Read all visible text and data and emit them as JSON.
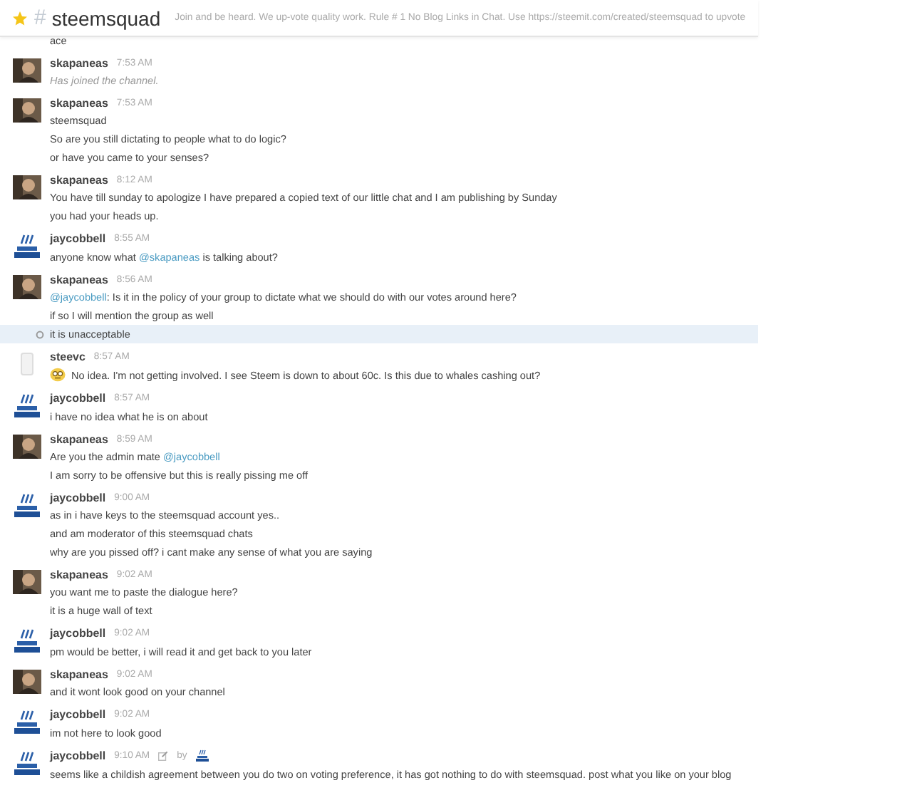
{
  "channel": {
    "starred": true,
    "hash": "#",
    "name": "steemsquad",
    "topic": "Join and be heard. We up-vote quality work. Rule # 1 No Blog Links in Chat. Use https://steemit.com/created/steemsquad to upvote"
  },
  "partial_line": "ace",
  "messages": [
    {
      "author": "skapaneas",
      "kind": "photo",
      "time": "7:53 AM",
      "edited": false,
      "lines": [
        {
          "kind": "system",
          "highlighted": false,
          "parts": [
            {
              "text": "Has joined the channel."
            }
          ]
        }
      ]
    },
    {
      "author": "skapaneas",
      "kind": "photo",
      "time": "7:53 AM",
      "edited": false,
      "lines": [
        {
          "kind": "text",
          "highlighted": false,
          "parts": [
            {
              "text": "steemsquad"
            }
          ]
        },
        {
          "kind": "text",
          "highlighted": false,
          "parts": [
            {
              "text": "So are you still dictating to people what to do logic?"
            }
          ]
        },
        {
          "kind": "text",
          "highlighted": false,
          "parts": [
            {
              "text": "or have you came to your senses?"
            }
          ]
        }
      ]
    },
    {
      "author": "skapaneas",
      "kind": "photo",
      "time": "8:12 AM",
      "edited": false,
      "lines": [
        {
          "kind": "text",
          "highlighted": false,
          "parts": [
            {
              "text": "You have till sunday to apologize I have prepared a copied text of our little chat and I am publishing by Sunday"
            }
          ]
        },
        {
          "kind": "text",
          "highlighted": false,
          "parts": [
            {
              "text": "you had your heads up."
            }
          ]
        }
      ]
    },
    {
      "author": "jaycobbell",
      "kind": "logo",
      "time": "8:55 AM",
      "edited": false,
      "lines": [
        {
          "kind": "text",
          "highlighted": false,
          "parts": [
            {
              "text": "anyone know what "
            },
            {
              "mention": "@skapaneas"
            },
            {
              "text": " is talking about?"
            }
          ]
        }
      ]
    },
    {
      "author": "skapaneas",
      "kind": "photo",
      "time": "8:56 AM",
      "edited": false,
      "lines": [
        {
          "kind": "text",
          "highlighted": false,
          "parts": [
            {
              "mention": "@jaycobbell"
            },
            {
              "text": ": Is it in the policy of your group to dictate what we should do with our votes around here?"
            }
          ]
        },
        {
          "kind": "text",
          "highlighted": false,
          "parts": [
            {
              "text": "if so I will mention the group as well"
            }
          ]
        },
        {
          "kind": "text",
          "highlighted": true,
          "parts": [
            {
              "text": "it is unacceptable"
            }
          ]
        }
      ]
    },
    {
      "author": "steevc",
      "kind": "blank",
      "time": "8:57 AM",
      "edited": false,
      "lines": [
        {
          "kind": "emoji",
          "highlighted": false,
          "parts": [
            {
              "text": "No idea. I'm not getting involved. I see Steem is down to about 60c. Is this due to whales cashing out?"
            }
          ]
        }
      ]
    },
    {
      "author": "jaycobbell",
      "kind": "logo",
      "time": "8:57 AM",
      "edited": false,
      "lines": [
        {
          "kind": "text",
          "highlighted": false,
          "parts": [
            {
              "text": "i have no idea what he is on about"
            }
          ]
        }
      ]
    },
    {
      "author": "skapaneas",
      "kind": "photo",
      "time": "8:59 AM",
      "edited": false,
      "lines": [
        {
          "kind": "text",
          "highlighted": false,
          "parts": [
            {
              "text": "Are you the admin mate "
            },
            {
              "mention": "@jaycobbell"
            }
          ]
        },
        {
          "kind": "text",
          "highlighted": false,
          "parts": [
            {
              "text": "I am sorry to be offensive but this is really pissing me off"
            }
          ]
        }
      ]
    },
    {
      "author": "jaycobbell",
      "kind": "logo",
      "time": "9:00 AM",
      "edited": false,
      "lines": [
        {
          "kind": "text",
          "highlighted": false,
          "parts": [
            {
              "text": "as in i have keys to the steemsquad account yes.."
            }
          ]
        },
        {
          "kind": "text",
          "highlighted": false,
          "parts": [
            {
              "text": "and am moderator of this steemsquad chats"
            }
          ]
        },
        {
          "kind": "text",
          "highlighted": false,
          "parts": [
            {
              "text": "why are you pissed off? i cant make any sense of what you are saying"
            }
          ]
        }
      ]
    },
    {
      "author": "skapaneas",
      "kind": "photo",
      "time": "9:02 AM",
      "edited": false,
      "lines": [
        {
          "kind": "text",
          "highlighted": false,
          "parts": [
            {
              "text": "you want me to paste the dialogue here?"
            }
          ]
        },
        {
          "kind": "text",
          "highlighted": false,
          "parts": [
            {
              "text": "it is a huge wall of text"
            }
          ]
        }
      ]
    },
    {
      "author": "jaycobbell",
      "kind": "logo",
      "time": "9:02 AM",
      "edited": false,
      "lines": [
        {
          "kind": "text",
          "highlighted": false,
          "parts": [
            {
              "text": "pm would be better, i will read it and get back to you later"
            }
          ]
        }
      ]
    },
    {
      "author": "skapaneas",
      "kind": "photo",
      "time": "9:02 AM",
      "edited": false,
      "lines": [
        {
          "kind": "text",
          "highlighted": false,
          "parts": [
            {
              "text": "and it wont look good on your channel"
            }
          ]
        }
      ]
    },
    {
      "author": "jaycobbell",
      "kind": "logo",
      "time": "9:02 AM",
      "edited": false,
      "lines": [
        {
          "kind": "text",
          "highlighted": false,
          "parts": [
            {
              "text": "im not here to look good"
            }
          ]
        }
      ]
    },
    {
      "author": "jaycobbell",
      "kind": "logo",
      "time": "9:10 AM",
      "edited": true,
      "edited_by": "by",
      "lines": [
        {
          "kind": "text",
          "highlighted": false,
          "parts": [
            {
              "text": "seems like a childish agreement between you do two on voting preference, it has got nothing to do with steemsquad. post what you like on your blog"
            }
          ]
        }
      ]
    }
  ]
}
